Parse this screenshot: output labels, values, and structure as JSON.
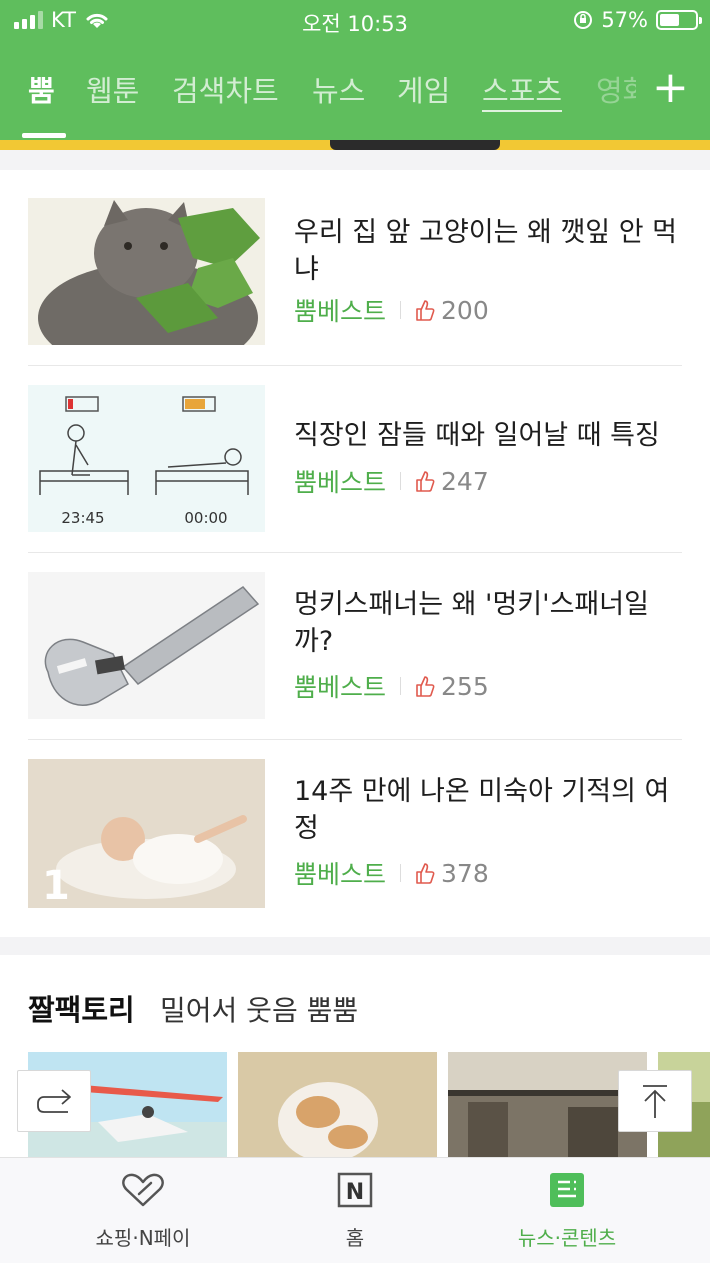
{
  "status_bar": {
    "carrier": "KT",
    "time": "오전 10:53",
    "battery_percent": "57%",
    "battery_level": 0.57
  },
  "tabs": [
    {
      "label": "뿜",
      "active": true
    },
    {
      "label": "웹툰"
    },
    {
      "label": "검색차트"
    },
    {
      "label": "뉴스"
    },
    {
      "label": "게임"
    },
    {
      "label": "스포츠"
    },
    {
      "label": "영화"
    }
  ],
  "add_tab_label": "+",
  "articles": [
    {
      "title": "우리 집 앞 고양이는 왜 깻잎 안 먹냐",
      "source": "뿜베스트",
      "likes": "200"
    },
    {
      "title": "직장인 잠들 때와 일어날 때 특징",
      "source": "뿜베스트",
      "likes": "247",
      "thumb_time_left": "23:45",
      "thumb_time_right": "00:00"
    },
    {
      "title": "멍키스패너는 왜 '멍키'스패너일까?",
      "source": "뿜베스트",
      "likes": "255"
    },
    {
      "title": "14주 만에 나온 미숙아 기적의 여정",
      "source": "뿜베스트",
      "likes": "378",
      "thumb_badge": "1"
    }
  ],
  "section2": {
    "title": "짤팩토리",
    "subtitle": "밀어서 웃음 뿜뿜"
  },
  "bottom_nav": [
    {
      "label": "쇼핑·N페이",
      "icon": "heart-icon"
    },
    {
      "label": "홈",
      "icon": "n-logo-icon",
      "glyph": "N"
    },
    {
      "label": "뉴스·콘텐츠",
      "icon": "news-icon",
      "active": true
    }
  ],
  "colors": {
    "brand_green": "#5fbe5d",
    "source_green": "#4fae4b",
    "like_red": "#e05a4e"
  }
}
